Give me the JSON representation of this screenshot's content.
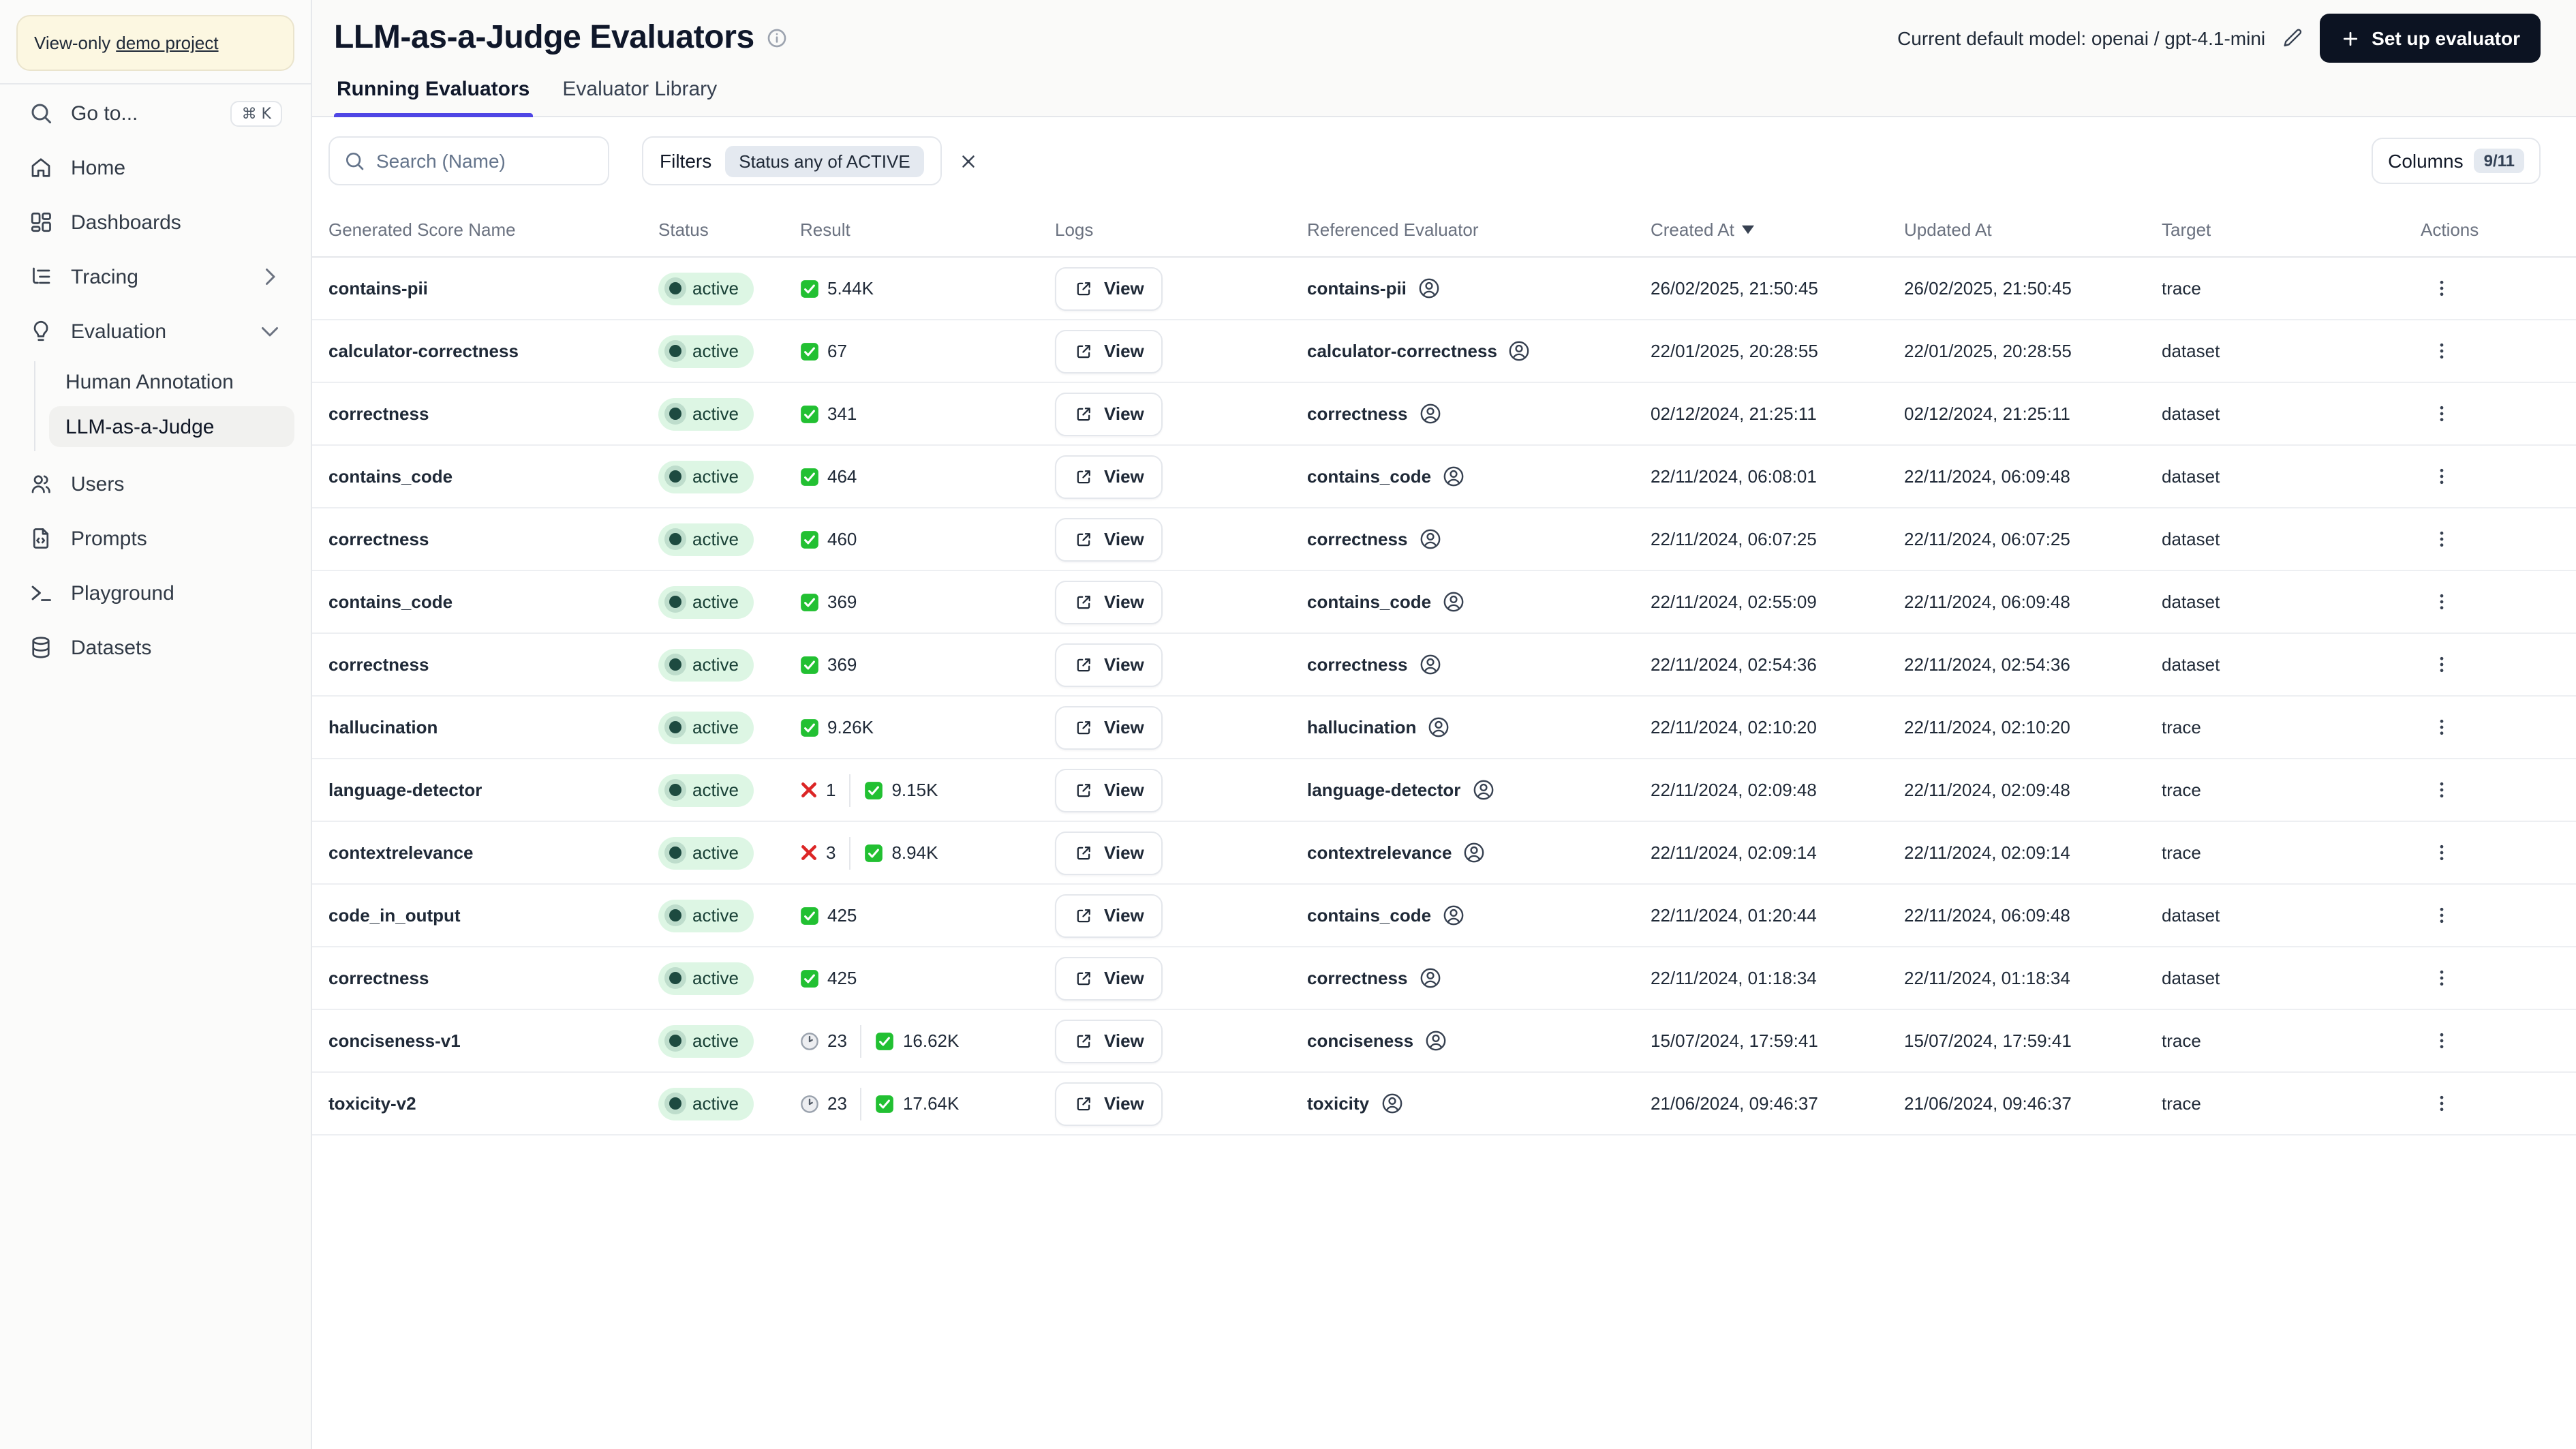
{
  "colors": {
    "accent": "#4f46e5",
    "primary_button_bg": "#0c1322",
    "active_badge_bg": "#ddf6e4",
    "active_badge_text": "#173f35",
    "success_green": "#22c032",
    "error_red": "#dc2626",
    "banner_bg": "#fcf7e1",
    "filter_chip_bg": "#e4e9f0"
  },
  "sidebar": {
    "banner": {
      "prefix": "View-only",
      "link_label": "demo project"
    },
    "goto": {
      "label": "Go to...",
      "shortcut": "⌘ K"
    },
    "items": [
      {
        "label": "Home"
      },
      {
        "label": "Dashboards"
      },
      {
        "label": "Tracing",
        "chevron": "right"
      },
      {
        "label": "Evaluation",
        "chevron": "down"
      }
    ],
    "evaluation_sub_items": [
      {
        "label": "Human Annotation",
        "selected": false
      },
      {
        "label": "LLM-as-a-Judge",
        "selected": true
      }
    ],
    "items_bottom": [
      {
        "label": "Users"
      },
      {
        "label": "Prompts"
      },
      {
        "label": "Playground"
      },
      {
        "label": "Datasets"
      }
    ]
  },
  "header": {
    "title": "LLM-as-a-Judge Evaluators",
    "model_label": "Current default model: openai / gpt-4.1-mini",
    "setup_button_label": "Set up evaluator"
  },
  "tabs": [
    {
      "label": "Running Evaluators",
      "active": true
    },
    {
      "label": "Evaluator Library",
      "active": false
    }
  ],
  "toolbar": {
    "search_placeholder": "Search (Name)",
    "filters_label": "Filters",
    "filter_chip": "Status any of ACTIVE",
    "columns_label": "Columns",
    "columns_badge": "9/11"
  },
  "table": {
    "columns": [
      "Generated Score Name",
      "Status",
      "Result",
      "Logs",
      "Referenced Evaluator",
      "Created At",
      "Updated At",
      "Target",
      "Actions"
    ],
    "sorted_by": "Created At",
    "sort_direction": "desc",
    "view_label": "View",
    "rows": [
      {
        "name": "contains-pii",
        "status": "active",
        "result": {
          "success": "5.44K"
        },
        "evaluator": "contains-pii",
        "created": "26/02/2025, 21:50:45",
        "updated": "26/02/2025, 21:50:45",
        "target": "trace"
      },
      {
        "name": "calculator-correctness",
        "status": "active",
        "result": {
          "success": "67"
        },
        "evaluator": "calculator-correctness",
        "created": "22/01/2025, 20:28:55",
        "updated": "22/01/2025, 20:28:55",
        "target": "dataset"
      },
      {
        "name": "correctness",
        "status": "active",
        "result": {
          "success": "341"
        },
        "evaluator": "correctness",
        "created": "02/12/2024, 21:25:11",
        "updated": "02/12/2024, 21:25:11",
        "target": "dataset"
      },
      {
        "name": "contains_code",
        "status": "active",
        "result": {
          "success": "464"
        },
        "evaluator": "contains_code",
        "created": "22/11/2024, 06:08:01",
        "updated": "22/11/2024, 06:09:48",
        "target": "dataset"
      },
      {
        "name": "correctness",
        "status": "active",
        "result": {
          "success": "460"
        },
        "evaluator": "correctness",
        "created": "22/11/2024, 06:07:25",
        "updated": "22/11/2024, 06:07:25",
        "target": "dataset"
      },
      {
        "name": "contains_code",
        "status": "active",
        "result": {
          "success": "369"
        },
        "evaluator": "contains_code",
        "created": "22/11/2024, 02:55:09",
        "updated": "22/11/2024, 06:09:48",
        "target": "dataset"
      },
      {
        "name": "correctness",
        "status": "active",
        "result": {
          "success": "369"
        },
        "evaluator": "correctness",
        "created": "22/11/2024, 02:54:36",
        "updated": "22/11/2024, 02:54:36",
        "target": "dataset"
      },
      {
        "name": "hallucination",
        "status": "active",
        "result": {
          "success": "9.26K"
        },
        "evaluator": "hallucination",
        "created": "22/11/2024, 02:10:20",
        "updated": "22/11/2024, 02:10:20",
        "target": "trace"
      },
      {
        "name": "language-detector",
        "status": "active",
        "result": {
          "error": "1",
          "success": "9.15K"
        },
        "evaluator": "language-detector",
        "created": "22/11/2024, 02:09:48",
        "updated": "22/11/2024, 02:09:48",
        "target": "trace"
      },
      {
        "name": "contextrelevance",
        "status": "active",
        "result": {
          "error": "3",
          "success": "8.94K"
        },
        "evaluator": "contextrelevance",
        "created": "22/11/2024, 02:09:14",
        "updated": "22/11/2024, 02:09:14",
        "target": "trace"
      },
      {
        "name": "code_in_output",
        "status": "active",
        "result": {
          "success": "425"
        },
        "evaluator": "contains_code",
        "created": "22/11/2024, 01:20:44",
        "updated": "22/11/2024, 06:09:48",
        "target": "dataset"
      },
      {
        "name": "correctness",
        "status": "active",
        "result": {
          "success": "425"
        },
        "evaluator": "correctness",
        "created": "22/11/2024, 01:18:34",
        "updated": "22/11/2024, 01:18:34",
        "target": "dataset"
      },
      {
        "name": "conciseness-v1",
        "status": "active",
        "result": {
          "pending": "23",
          "success": "16.62K"
        },
        "evaluator": "conciseness",
        "created": "15/07/2024, 17:59:41",
        "updated": "15/07/2024, 17:59:41",
        "target": "trace"
      },
      {
        "name": "toxicity-v2",
        "status": "active",
        "result": {
          "pending": "23",
          "success": "17.64K"
        },
        "evaluator": "toxicity",
        "created": "21/06/2024, 09:46:37",
        "updated": "21/06/2024, 09:46:37",
        "target": "trace"
      }
    ]
  }
}
